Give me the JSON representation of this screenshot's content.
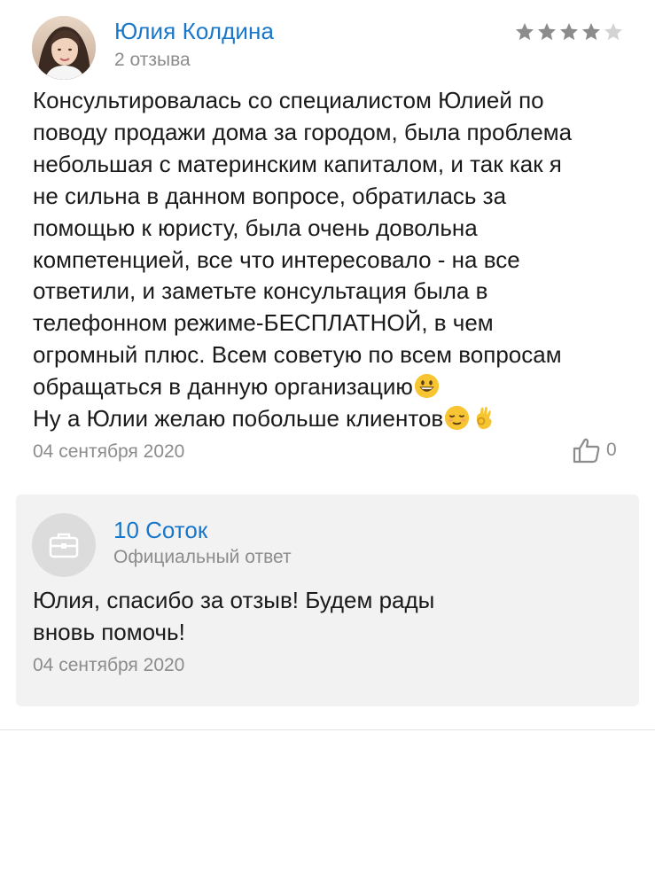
{
  "review": {
    "author_name": "Юлия Колдина",
    "author_meta": "2 отзыва",
    "rating": 4,
    "rating_max": 5,
    "text_lines": [
      "Консультировалась со специалистом Юлией по",
      "поводу продажи дома за городом, была проблема",
      "небольшая с материнским капиталом, и так как я",
      "не сильна в данном вопросе, обратилась за",
      "помощью к юристу, была очень довольна",
      "компетенцией, все что интересовало - на все",
      "ответили, и заметьте консультация была в",
      "телефонном режиме-БЕСПЛАТНОЙ, в чем",
      "огромный плюс. Всем советую по всем вопросам",
      "обращаться в данную организацию",
      "Ну а Юлии желаю побольше клиентов"
    ],
    "date": "04 сентября 2020",
    "likes": "0",
    "icons": [
      "star-icon",
      "grinning-emoji-icon",
      "relieved-emoji-icon",
      "ok-hand-emoji-icon",
      "thumbs-up-icon"
    ]
  },
  "reply": {
    "name": "10 Соток",
    "meta": "Официальный ответ",
    "text": "Юлия, спасибо за отзыв! Будем рады\nвновь помочь!",
    "date": "04 сентября 2020",
    "icon": "briefcase-icon"
  },
  "colors": {
    "link_blue": "#1877c9",
    "muted_gray": "#8c8c8c",
    "star_filled": "#8c8c8c",
    "star_empty": "#d3d3d3",
    "reply_background": "#f2f2f2"
  }
}
